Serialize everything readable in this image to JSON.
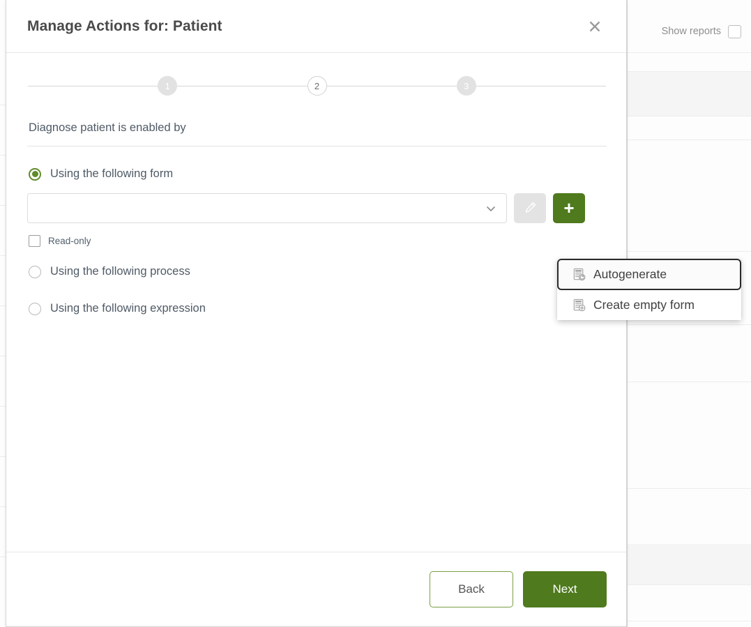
{
  "background": {
    "show_reports_label": "Show reports",
    "show_reports_checked": false
  },
  "modal": {
    "title": "Manage Actions for: Patient",
    "close_icon": "close-icon",
    "stepper": {
      "steps": [
        {
          "number": "1",
          "state": "done"
        },
        {
          "number": "2",
          "state": "active"
        },
        {
          "number": "3",
          "state": "done"
        }
      ]
    },
    "prompt": "Diagnose patient is enabled by",
    "options": [
      {
        "label": "Using the following form",
        "selected": true
      },
      {
        "label": "Using the following process",
        "selected": false
      },
      {
        "label": "Using the following expression",
        "selected": false
      }
    ],
    "form_select": {
      "value": "",
      "placeholder": "",
      "chevron_icon": "chevron-down-icon"
    },
    "edit_button": {
      "icon": "pencil-icon",
      "disabled": true
    },
    "add_button": {
      "icon": "plus-icon",
      "label": "+"
    },
    "readonly": {
      "label": "Read-only",
      "checked": false
    },
    "footer": {
      "back_label": "Back",
      "next_label": "Next"
    }
  },
  "popup_menu": {
    "items": [
      {
        "label": "Autogenerate",
        "icon": "form-refresh-icon",
        "focused": true
      },
      {
        "label": "Create empty form",
        "icon": "form-plus-icon",
        "focused": false
      }
    ]
  },
  "colors": {
    "primary_green": "#4f7a1e",
    "radio_green": "#5f8b28",
    "outline_green": "#7a9e45",
    "text_dark": "#4a4a4a",
    "text_body": "#4f5a66",
    "muted": "#8f8f8f"
  }
}
